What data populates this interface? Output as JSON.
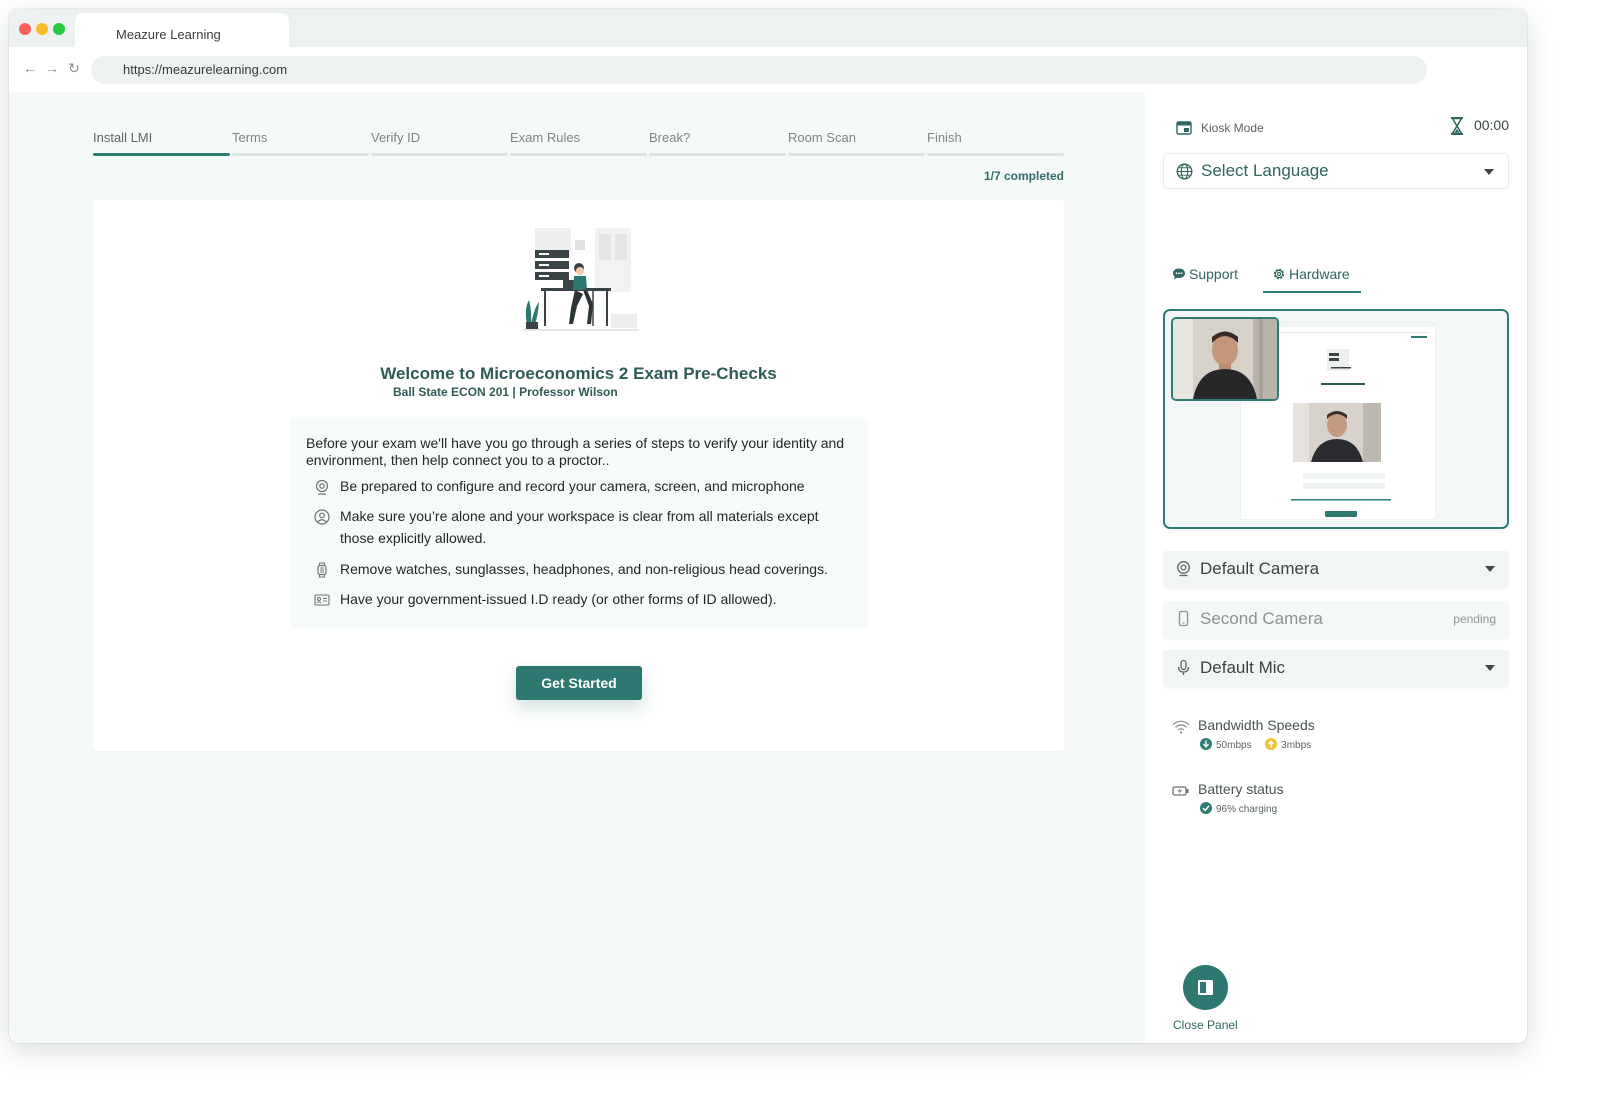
{
  "browser": {
    "tab_title": "Meazure Learning",
    "url": "https://meazurelearning.com",
    "back_glyph": "←",
    "forward_glyph": "→",
    "reload_glyph": "↻"
  },
  "steps": {
    "items": [
      {
        "label": "Install LMI",
        "active": true
      },
      {
        "label": "Terms",
        "active": false
      },
      {
        "label": "Verify ID",
        "active": false
      },
      {
        "label": "Exam Rules",
        "active": false
      },
      {
        "label": "Break?",
        "active": false
      },
      {
        "label": "Room Scan",
        "active": false
      },
      {
        "label": "Finish",
        "active": false
      }
    ],
    "completed_text": "1/7 completed",
    "completed_count": 1,
    "total_count": 7
  },
  "welcome": {
    "title": "Welcome to Microeconomics 2 Exam Pre-Checks",
    "subtitle": "Ball State ECON 201 | Professor Wilson",
    "intro": "Before your exam we'll have you go through a series of steps to verify your identity and environment, then help connect you to a proctor..",
    "requirements": [
      {
        "icon": "webcam-icon",
        "text": "Be prepared to configure and record your camera, screen, and microphone"
      },
      {
        "icon": "person-icon",
        "text": "Make sure you’re alone and your workspace is clear from all materials except those explicitly allowed."
      },
      {
        "icon": "watch-icon",
        "text": "Remove watches, sunglasses, headphones, and non-religious head coverings."
      },
      {
        "icon": "id-card-icon",
        "text": "Have your government-issued I.D ready (or other forms of ID allowed)."
      }
    ],
    "button_label": "Get Started"
  },
  "panel": {
    "kiosk_label": "Kiosk Mode",
    "timer": "00:00",
    "language_select": "Select Language",
    "tabs": [
      {
        "label": "Support",
        "icon": "chat-bubble-icon",
        "active": false
      },
      {
        "label": "Hardware",
        "icon": "gear-icon",
        "active": true
      }
    ],
    "devices": {
      "camera": "Default Camera",
      "second_camera": "Second Camera",
      "second_camera_status": "pending",
      "mic": "Default Mic"
    },
    "bandwidth": {
      "title": "Bandwidth Speeds",
      "download": "50mbps",
      "upload": "3mbps"
    },
    "battery": {
      "title": "Battery status",
      "status": "96% charging"
    },
    "close_label": "Close Panel"
  },
  "colors": {
    "primary": "#2e7871",
    "content_bg": "#f5faf9",
    "upload_dot": "#f2c037",
    "text_dark": "#1f2626"
  }
}
